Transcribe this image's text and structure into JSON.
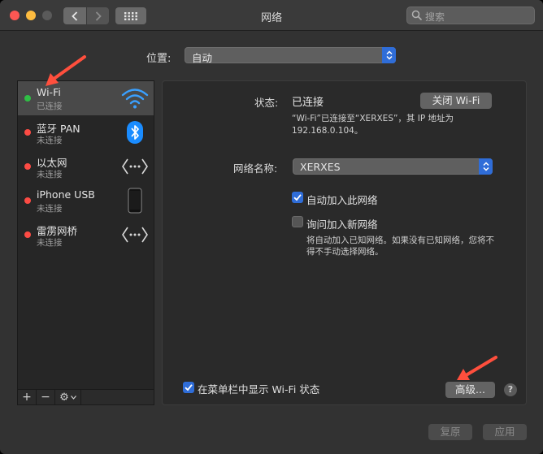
{
  "window": {
    "title": "网络"
  },
  "search": {
    "placeholder": "搜索"
  },
  "location": {
    "label": "位置:",
    "value": "自动"
  },
  "services": [
    {
      "name": "Wi-Fi",
      "status": "已连接",
      "dot_color": "#2fbf45",
      "icon": "wifi-icon"
    },
    {
      "name": "蓝牙 PAN",
      "status": "未连接",
      "dot_color": "#fc4b44",
      "icon": "bluetooth-icon"
    },
    {
      "name": "以太网",
      "status": "未连接",
      "dot_color": "#fc4b44",
      "icon": "ethernet-icon"
    },
    {
      "name": "iPhone USB",
      "status": "未连接",
      "dot_color": "#fc4b44",
      "icon": "iphone-icon"
    },
    {
      "name": "雷雳网桥",
      "status": "未连接",
      "dot_color": "#fc4b44",
      "icon": "thunderbolt-bridge-icon"
    }
  ],
  "toolbar": {
    "add": "+",
    "remove": "−",
    "gear": "⚙"
  },
  "detail": {
    "status_label": "状态:",
    "status_value": "已连接",
    "turn_off_wifi": "关闭 Wi-Fi",
    "status_desc_line1": "“Wi-Fi”已连接至“XERXES”，其 IP 地址为",
    "status_desc_line2": "192.168.0.104。",
    "network_name_label": "网络名称:",
    "network_name_value": "XERXES",
    "auto_join_label": "自动加入此网络",
    "auto_join_checked": true,
    "ask_join_label": "询问加入新网络",
    "ask_join_checked": false,
    "ask_join_desc_line1": "将自动加入已知网络。如果没有已知网络，您将不",
    "ask_join_desc_line2": "得不手动选择网络。",
    "show_menubar_label": "在菜单栏中显示 Wi-Fi 状态",
    "show_menubar_checked": true,
    "advanced": "高级...",
    "help": "?"
  },
  "footer": {
    "revert": "复原",
    "apply": "应用"
  },
  "colors": {
    "accent": "#2f6dd8",
    "annotation_arrow": "#ff4f3d"
  }
}
